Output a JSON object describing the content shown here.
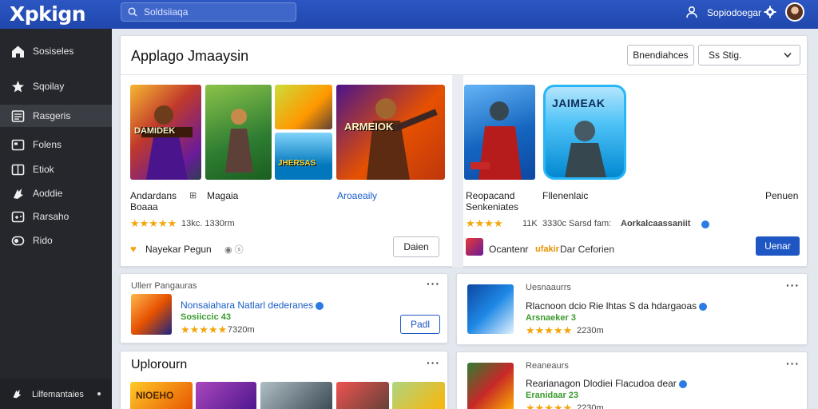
{
  "app": {
    "logo": "Xpkign",
    "username": "Sopiodoegar"
  },
  "search": {
    "placeholder": "Soldsiiaqa"
  },
  "sidebar": {
    "items": [
      {
        "label": "Sosiseles",
        "icon": "home-icon"
      },
      {
        "label": "Sqoilay",
        "icon": "star-icon"
      },
      {
        "label": "Rasgeris",
        "icon": "list-icon"
      },
      {
        "label": "Folens",
        "icon": "folder-icon"
      },
      {
        "label": "Etiok",
        "icon": "book-icon"
      },
      {
        "label": "Aoddie",
        "icon": "puzzle-icon"
      },
      {
        "label": "Rarsaho",
        "icon": "gamepad-icon"
      },
      {
        "label": "Rido",
        "icon": "toggle-icon"
      }
    ],
    "bottom_label": "Lilfemantaies"
  },
  "main": {
    "title": "Applago Jmaaysin",
    "filter_button": "Bnendiahces",
    "sort_select": "Sѕ Stig.",
    "left_panel": {
      "game_title": "Andardans",
      "game_title2": "Magaia",
      "subtitle": "Boaaa",
      "link": "Aroaeaily",
      "rating": "★★★★★",
      "meta": "13kc. 1330rm",
      "developer": "Nayekar Pegun",
      "button": "Daien"
    },
    "right_panel": {
      "game_title": "Reopacand",
      "game_sub": "Senkeniates",
      "game2_title": "Fllenenlaic",
      "side_label": "Penuen",
      "rating": "★★★★",
      "meta": "11K",
      "meta2": "3330c Sarsd fam:",
      "link": "Aorkalcaassaniit",
      "developer": "Ocantenr",
      "dev_tag": "ufakir",
      "dev_extra": "Dar Ceforien",
      "button": "Uenar",
      "thumb_text": "JAIMEAK"
    }
  },
  "left_small_card": {
    "header": "Ullerr Pangauras",
    "title": "Nonsaiahara Natlarl dederanes",
    "tag": "Sosiiccic 43",
    "rating": "★★★★★",
    "meta": "7320m",
    "button": "Padl"
  },
  "right_card1": {
    "header": "Uesnaaurrs",
    "title": "Rlacnoon dcio Rie lhtas S da hdargaoas",
    "tag": "Arsnaeker 3",
    "rating": "★★★★★",
    "meta": "2230m"
  },
  "right_card2": {
    "header": "Reaneaurs",
    "title": "Rearianagon Dlodiei Flacudoa dear",
    "tag": "Eranidaar 23",
    "rating": "★★★★★",
    "meta": "2230m"
  },
  "uploads": {
    "title": "Uplorourn"
  },
  "thumb_texts": {
    "t1": "DAMIDEK",
    "t2": "JHERSAS",
    "t3": "ARMEIOK",
    "t4": "NIOEHO"
  },
  "colors": {
    "topbar": "#2c56c2",
    "sidebar": "#25272d",
    "accent": "#1e56c4",
    "star": "#f3a50c"
  }
}
